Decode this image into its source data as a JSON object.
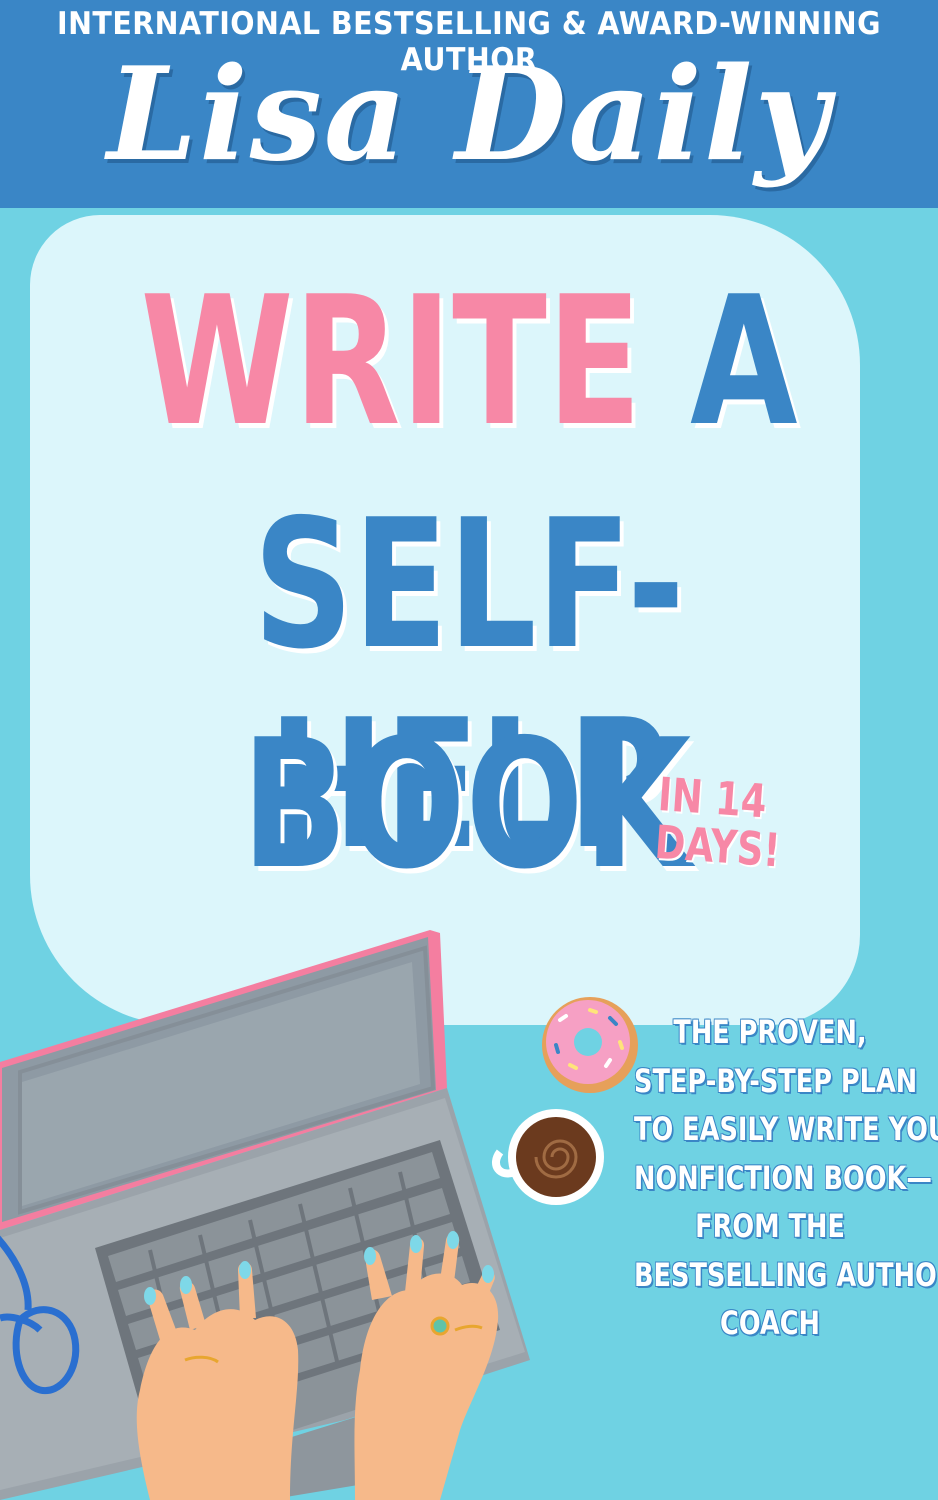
{
  "cover": {
    "tagline": "INTERNATIONAL BESTSELLING & AWARD-WINNING AUTHOR",
    "author": "Lisa Daily",
    "title": {
      "word_pink": "WRITE",
      "word_a": "A",
      "line2": "SELF-HELP",
      "line3": "BOOK"
    },
    "badge": {
      "line1": "IN 14",
      "line2": "DAYS!"
    },
    "description": [
      "THE PROVEN,",
      "STEP-BY-STEP PLAN",
      "TO EASILY WRITE YOUR",
      "NONFICTION BOOK—",
      "FROM THE",
      "BESTSELLING AUTHOR",
      "COACH"
    ],
    "icons": [
      "laptop-icon",
      "hands-icon",
      "donut-icon",
      "coffee-cup-icon",
      "glasses-icon"
    ]
  },
  "colors": {
    "background": "#6fd2e3",
    "band": "#3a86c6",
    "panel": "#dcf6fb",
    "pink": "#f788a6",
    "blue": "#3a86c6",
    "white": "#ffffff"
  }
}
